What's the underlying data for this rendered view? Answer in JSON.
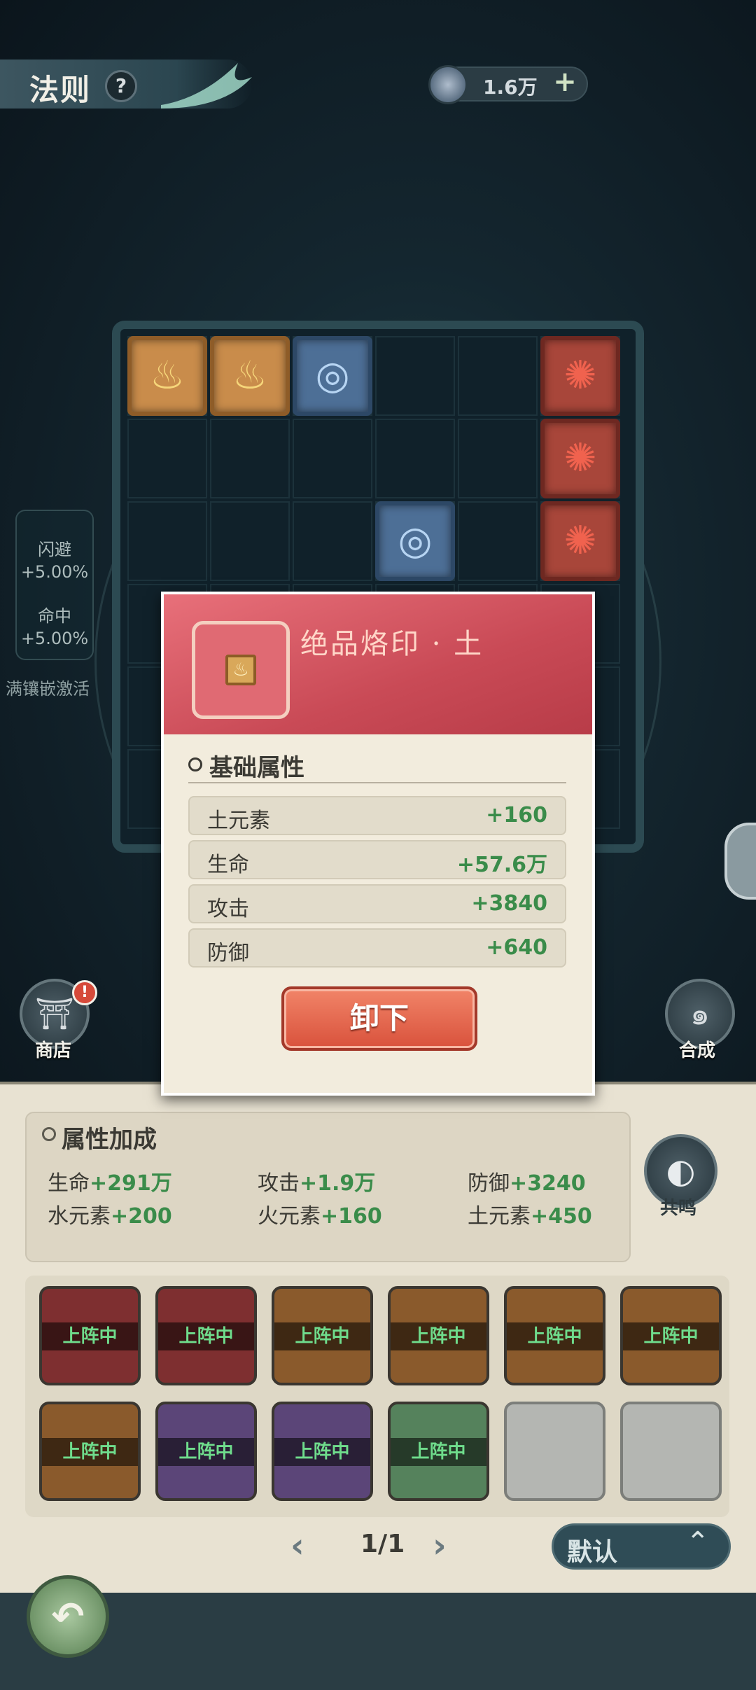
{
  "header": {
    "title": "法则",
    "help_icon": "help-icon",
    "currency_value": "1.6万",
    "currency_icon": "orb-icon",
    "plus_icon": "plus-icon"
  },
  "side_stats": {
    "dodge_label": "闪避",
    "dodge_value": "+5.00%",
    "hit_label": "命中",
    "hit_value": "+5.00%",
    "activate_text": "满镶嵌激活"
  },
  "shop": {
    "label": "商店",
    "badge": "!"
  },
  "synth": {
    "label": "合成"
  },
  "popup": {
    "title": "绝品烙印 · 土",
    "section_title": "基础属性",
    "stats": [
      {
        "name": "土元素",
        "value": "+160"
      },
      {
        "name": "生命",
        "value": "+57.6万"
      },
      {
        "name": "攻击",
        "value": "+3840"
      },
      {
        "name": "防御",
        "value": "+640"
      }
    ],
    "unequip_label": "卸下"
  },
  "attributes": {
    "title": "属性加成",
    "items": [
      {
        "name": "生命",
        "value": "+291万"
      },
      {
        "name": "攻击",
        "value": "+1.9万"
      },
      {
        "name": "防御",
        "value": "+3240"
      },
      {
        "name": "水元素",
        "value": "+200"
      },
      {
        "name": "火元素",
        "value": "+160"
      },
      {
        "name": "土元素",
        "value": "+450"
      }
    ]
  },
  "resonance": {
    "label": "共鸣"
  },
  "slots": [
    {
      "color": "red",
      "status": "上阵中"
    },
    {
      "color": "red",
      "status": "上阵中"
    },
    {
      "color": "orange",
      "status": "上阵中"
    },
    {
      "color": "orange",
      "status": "上阵中"
    },
    {
      "color": "orange",
      "status": "上阵中"
    },
    {
      "color": "orange",
      "status": "上阵中"
    },
    {
      "color": "orange",
      "status": "上阵中"
    },
    {
      "color": "purple",
      "status": "上阵中"
    },
    {
      "color": "purple",
      "status": "上阵中"
    },
    {
      "color": "green",
      "status": "上阵中"
    },
    {
      "color": "empty",
      "status": ""
    },
    {
      "color": "empty",
      "status": ""
    }
  ],
  "pager": {
    "text": "1/1"
  },
  "sort": {
    "label": "默认"
  },
  "board_tiles": [
    {
      "element": "earth",
      "glyph": "♨"
    },
    {
      "element": "earth",
      "glyph": "♨"
    },
    {
      "element": "water",
      "glyph": "◎"
    },
    {
      "element": "fire",
      "glyph": "✺"
    },
    {
      "element": "fire",
      "glyph": "✺"
    },
    {
      "element": "water",
      "glyph": "◎"
    },
    {
      "element": "fire",
      "glyph": "✺"
    }
  ]
}
